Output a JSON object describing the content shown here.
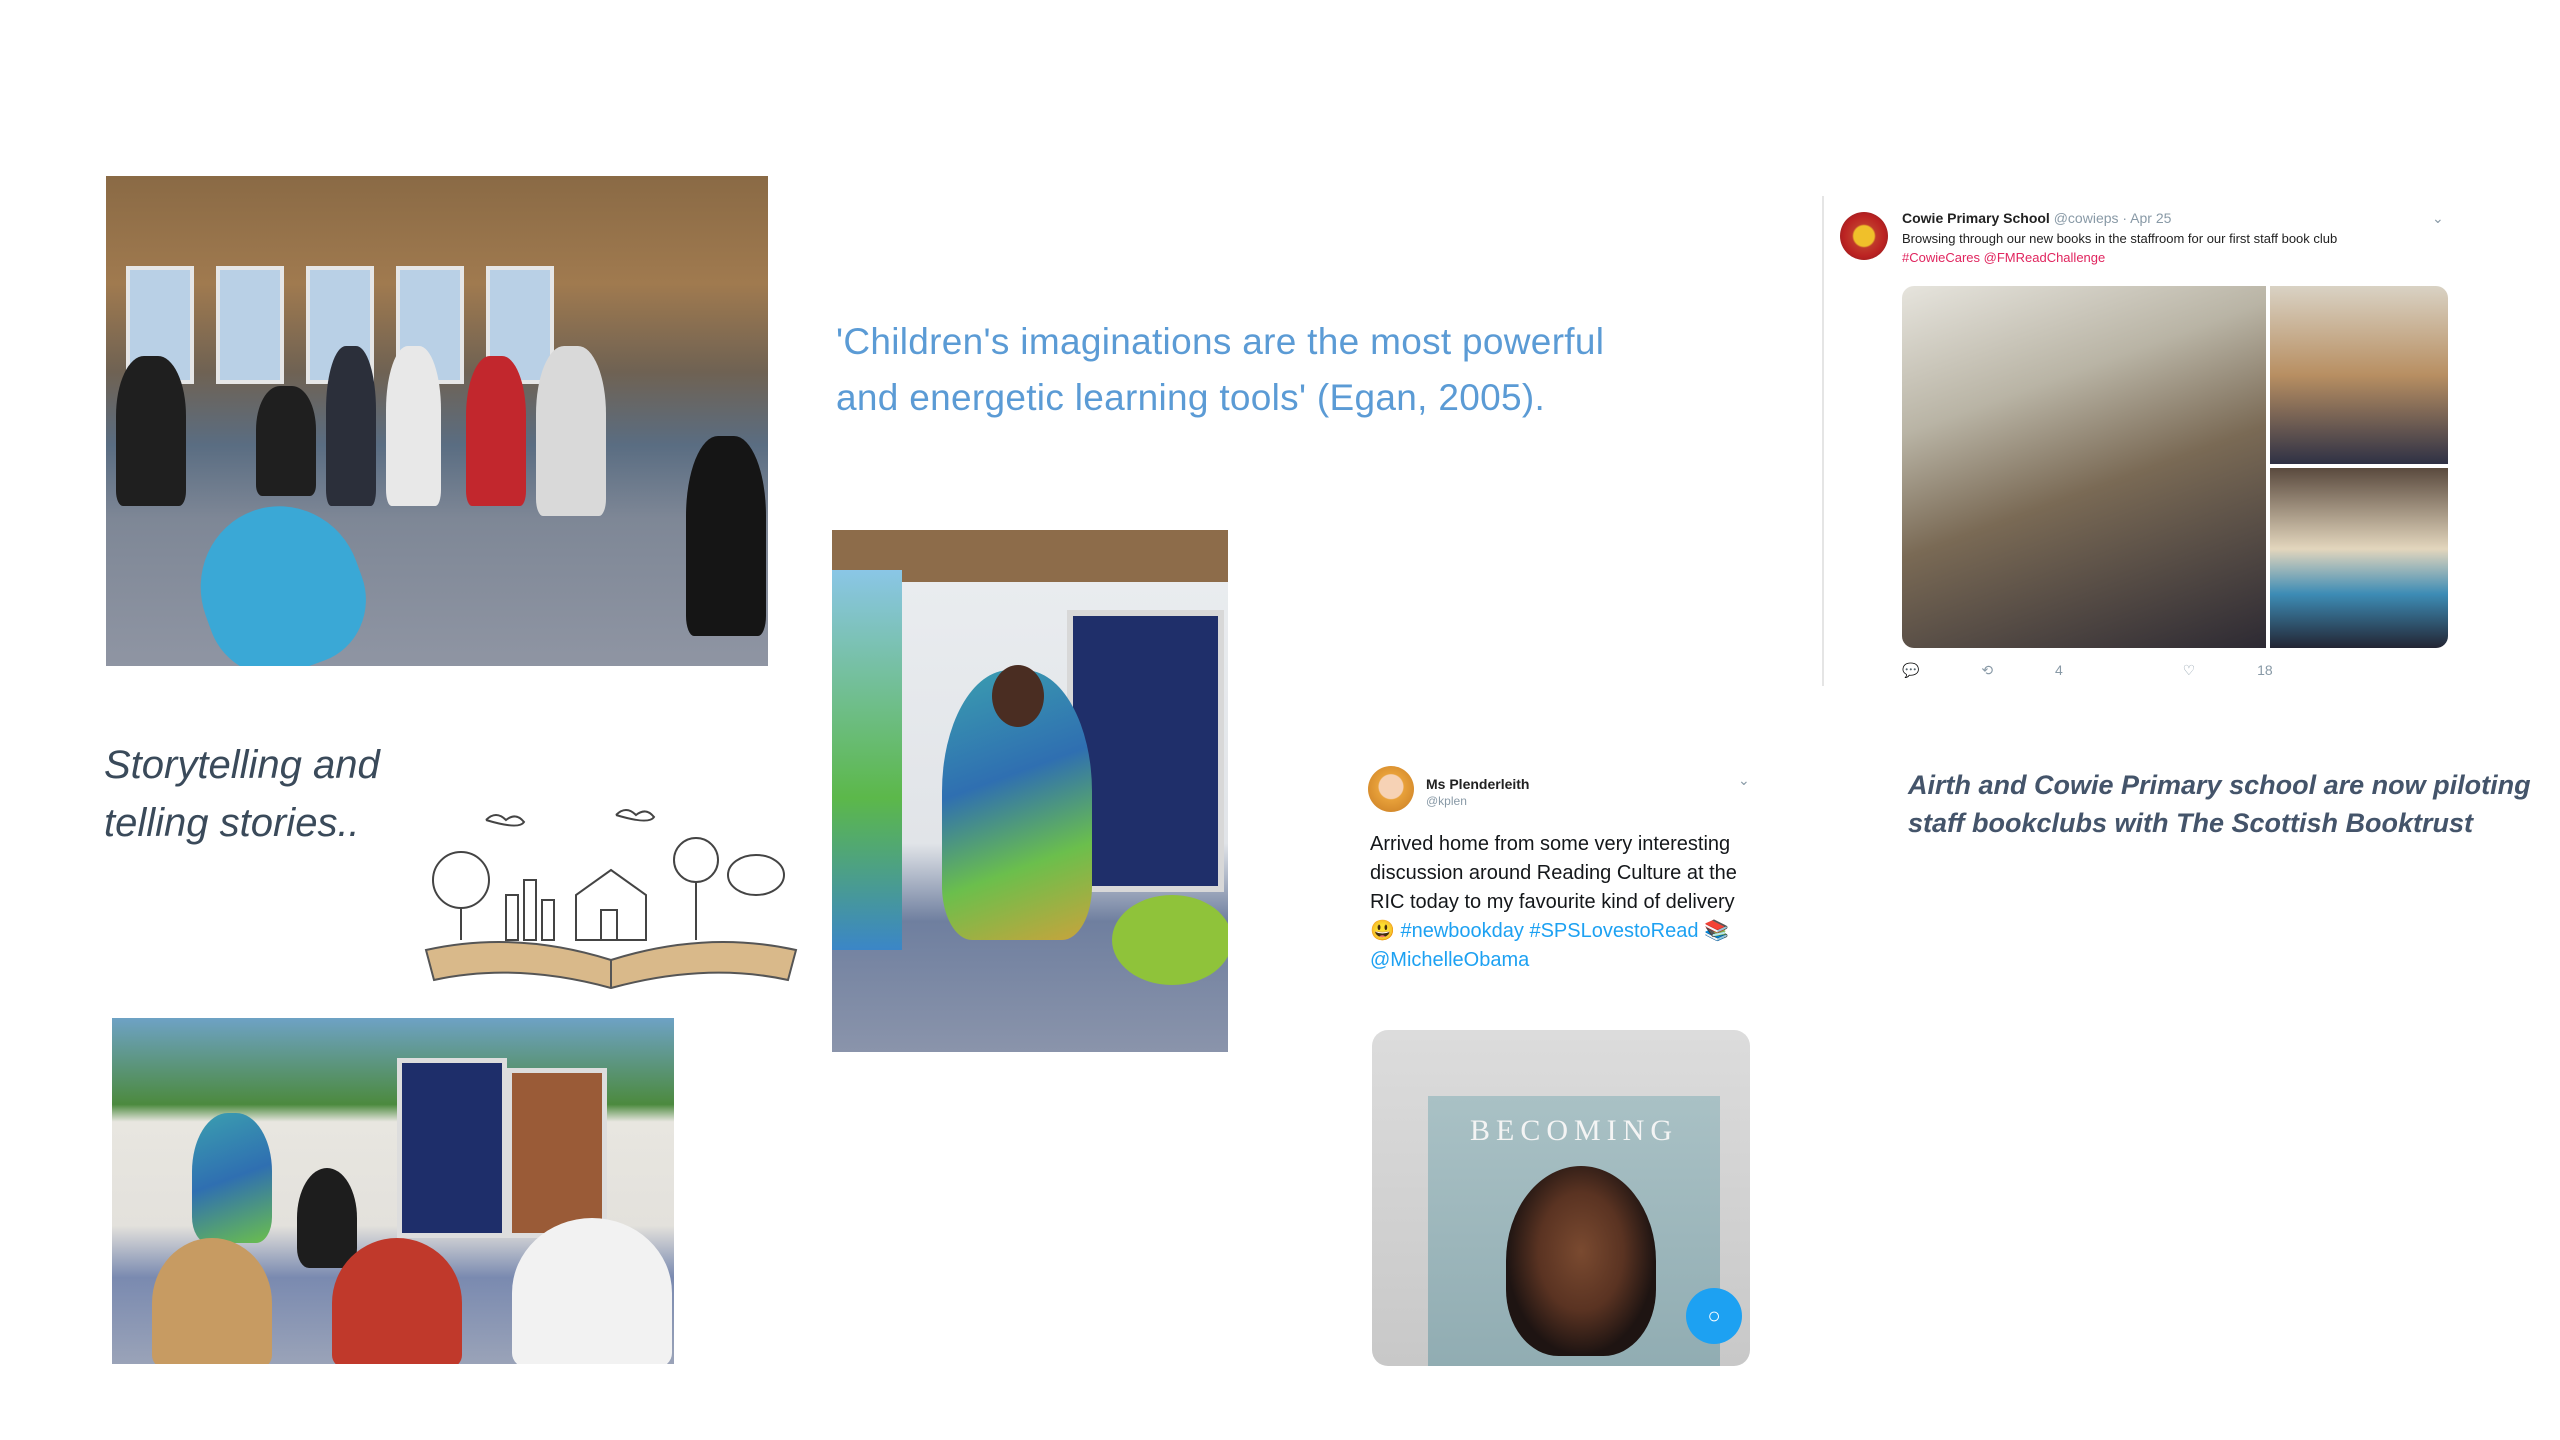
{
  "quote": "'Children's imaginations are the most powerful and energetic learning  tools' (Egan, 2005).",
  "storytelling": "Storytelling and telling stories..",
  "caption_airth": "Airth and Cowie Primary school are now piloting staff bookclubs with The Scottish Booktrust",
  "tweet_cowie": {
    "name": "Cowie Primary School",
    "handle": "@cowieps · Apr 25",
    "body": "Browsing through our new books in the staffroom for our first staff book club",
    "tags": "#CowieCares @FMReadChallenge",
    "retweets": "4",
    "likes": "18"
  },
  "tweet_plender": {
    "name": "Ms Plenderleith",
    "handle": "@kplen",
    "text_1": "Arrived home from some very interesting discussion around Reading Culture at the RIC today to my favourite kind of delivery 😃",
    "hashtag_1": "#newbookday",
    "hashtag_2": "#SPSLovestoRead",
    "mention": "@MichelleObama",
    "book_title": "BECOMING"
  },
  "colors": {
    "quote": "#5b9bd5",
    "caption": "#44546a",
    "twitter_blue": "#1da1f2"
  }
}
